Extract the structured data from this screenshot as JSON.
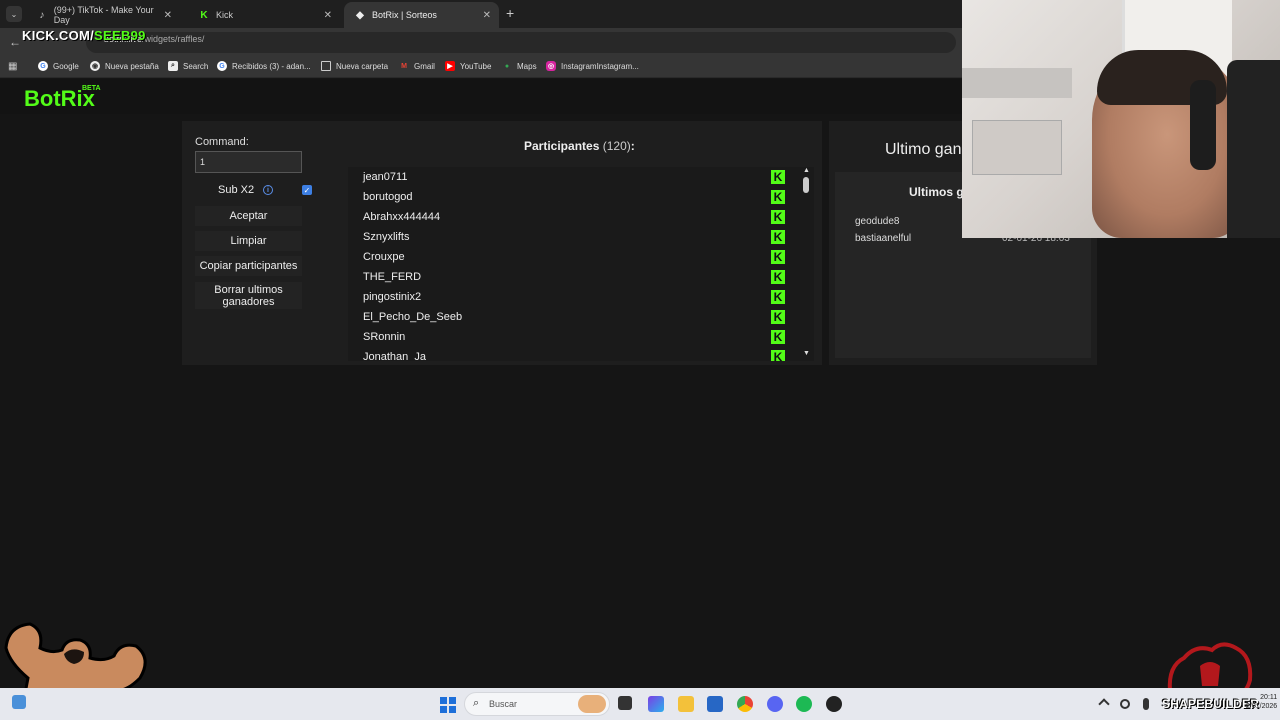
{
  "browser": {
    "tabs": [
      {
        "label": "(99+) TikTok - Make Your Day",
        "icon": "tiktok-icon"
      },
      {
        "label": "Kick",
        "icon": "kick-icon"
      },
      {
        "label": "BotRix | Sorteos",
        "icon": "botrix-icon",
        "active": true
      }
    ],
    "url_host": "botrix.live",
    "url_path": "/widgets/raffles/",
    "bookmarks": [
      "Google",
      "Nueva pestaña",
      "Search",
      "Recibidos (3) - adan...",
      "Nueva carpeta",
      "Gmail",
      "YouTube",
      "Maps",
      "InstagramInstagram..."
    ]
  },
  "overlay": {
    "kick_prefix": "KICK.COM/",
    "kick_channel": "SEEB99",
    "shapebuilder": "SHAPEBUILDER"
  },
  "site": {
    "logo": "BotRix",
    "beta": "BETA"
  },
  "controls": {
    "command_label": "Command:",
    "command_value": "1",
    "sub_x2_label": "Sub X2",
    "sub_x2_checked": true,
    "accept": "Aceptar",
    "clear": "Limpiar",
    "copy": "Copiar participantes",
    "delete_winners": "Borrar ultimos ganadores"
  },
  "participants": {
    "title": "Participantes",
    "count": "(120)",
    "colon": ":",
    "list": [
      "jean0711",
      "borutogod",
      "Abrahxx444444",
      "Sznyxlifts",
      "Crouxpe",
      "THE_FERD",
      "pingostinix2",
      "El_Pecho_De_Seeb",
      "SRonnin",
      "Jonathan_Ja"
    ]
  },
  "winners": {
    "last_winner_title": "Ultimo gan",
    "last_winners_title": "Ultimos g",
    "entries": [
      {
        "name": "geodude8",
        "date": ""
      },
      {
        "name": "bastiaanelful",
        "date": "02-01-26 18:03"
      }
    ]
  },
  "taskbar": {
    "search_placeholder": "Buscar",
    "time": "20:11",
    "date": "2/01/2026"
  },
  "colors": {
    "kick_green": "#53fc18",
    "accent_blue": "#3d7fe3"
  }
}
